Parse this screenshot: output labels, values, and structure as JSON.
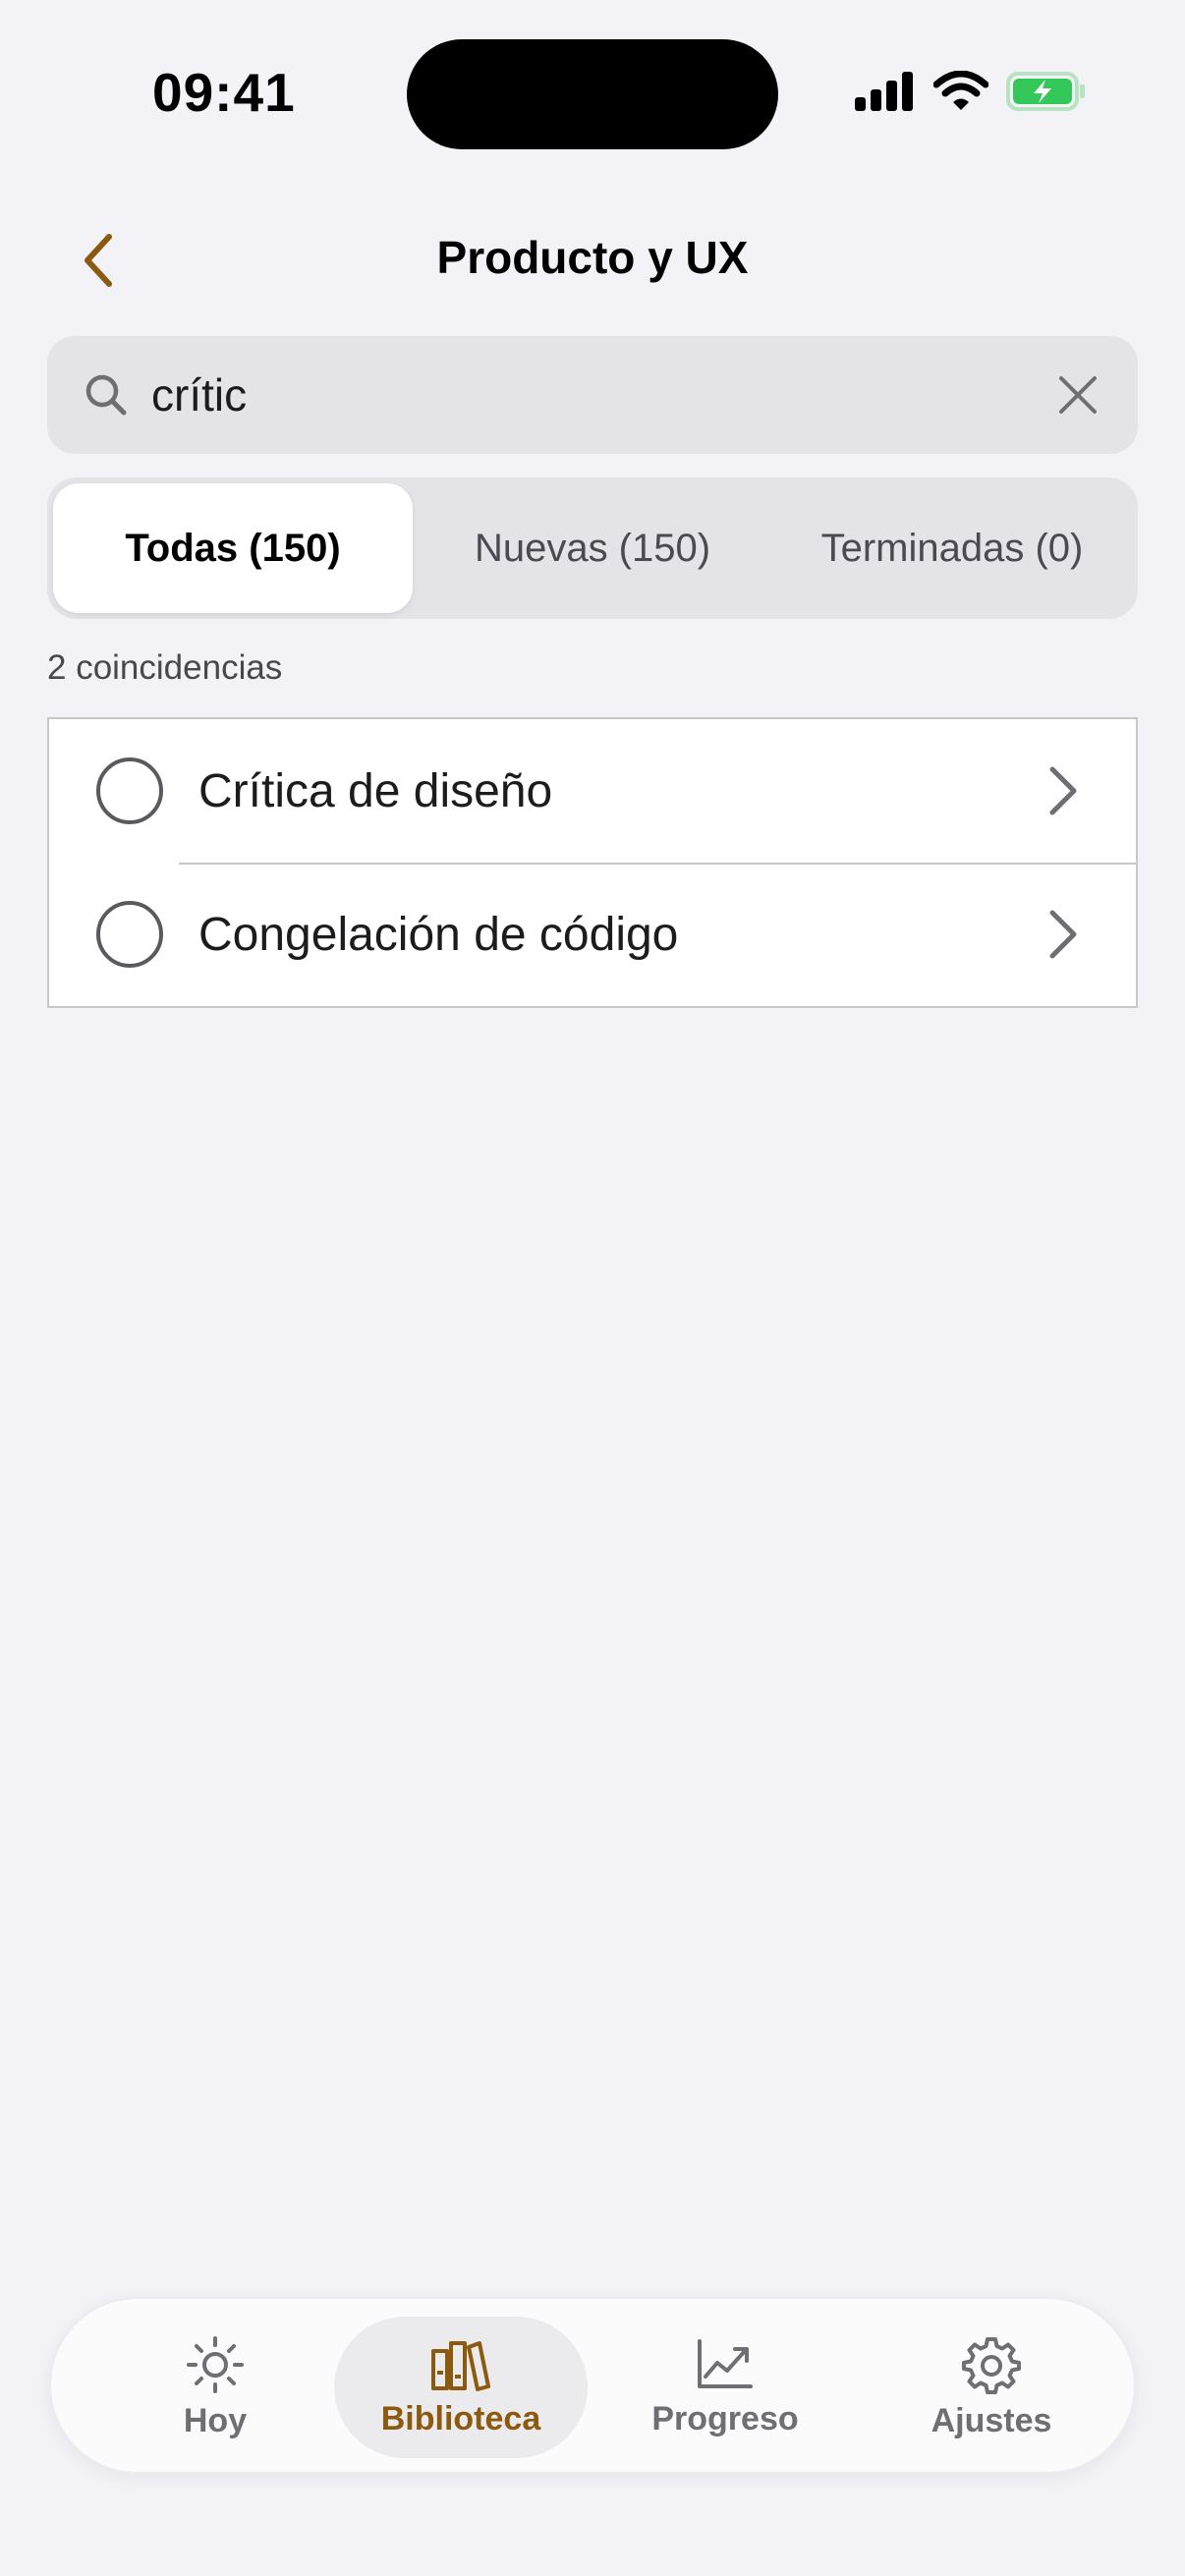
{
  "status_bar": {
    "time": "09:41"
  },
  "nav": {
    "title": "Producto y UX",
    "back_icon": "chevron-left-icon"
  },
  "search": {
    "value": "crític",
    "placeholder": ""
  },
  "segments": [
    {
      "label": "Todas (150)",
      "active": true
    },
    {
      "label": "Nuevas (150)",
      "active": false
    },
    {
      "label": "Terminadas (0)",
      "active": false
    }
  ],
  "results": {
    "count_label": "2 coincidencias",
    "items": [
      {
        "label": "Crítica de diseño"
      },
      {
        "label": "Congelación de código"
      }
    ]
  },
  "tabbar": {
    "items": [
      {
        "label": "Hoy",
        "icon": "sun-icon"
      },
      {
        "label": "Biblioteca",
        "icon": "books-icon",
        "active": true
      },
      {
        "label": "Progreso",
        "icon": "chart-icon"
      },
      {
        "label": "Ajustes",
        "icon": "gear-icon"
      }
    ]
  },
  "colors": {
    "accent": "#8b5a0f",
    "background": "#f2f2f7",
    "battery": "#34c759"
  }
}
